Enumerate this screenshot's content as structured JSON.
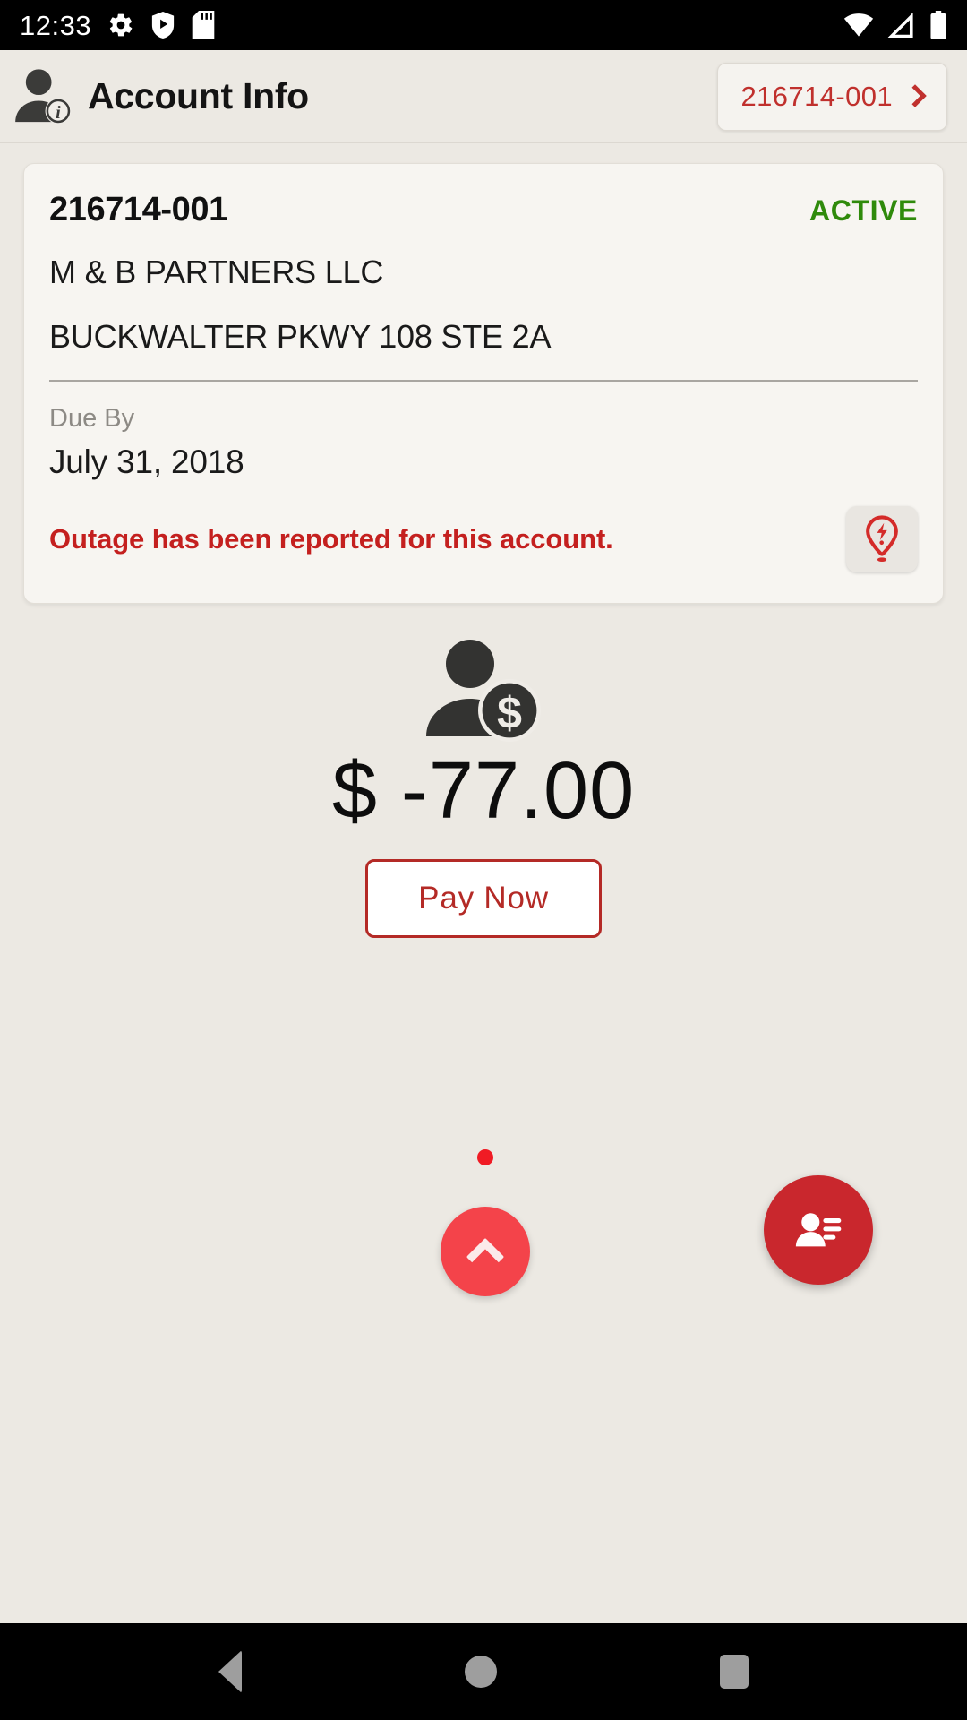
{
  "status_bar": {
    "time": "12:33",
    "left_icons": [
      "settings-gear-icon",
      "play-protect-icon",
      "sd-card-icon"
    ],
    "right_icons": [
      "wifi-icon",
      "cell-signal-icon",
      "battery-icon"
    ]
  },
  "header": {
    "icon": "account-info-person-icon",
    "title": "Account Info",
    "account_switcher": {
      "label": "216714-001",
      "chevron": "chevron-right-icon"
    }
  },
  "account_card": {
    "account_number": "216714-001",
    "status": "ACTIVE",
    "status_color": "#2f8a0b",
    "customer_name": "M & B PARTNERS LLC",
    "address": "BUCKWALTER PKWY 108 STE 2A",
    "due_by_label": "Due By",
    "due_by_value": "July 31, 2018",
    "outage_message": "Outage has been reported for this account.",
    "outage_message_color": "#c4201f",
    "outage_icon": "outage-pin-bolt-icon"
  },
  "balance": {
    "icon": "person-dollar-icon",
    "currency_symbol": "$",
    "amount": "-77.00",
    "display": "$ -77.00",
    "pay_button_label": "Pay Now",
    "pay_button_color": "#b42a26"
  },
  "floating": {
    "notification_dot": "red-dot-indicator",
    "expand_fab": "chevron-up-fab",
    "expand_fab_color": "#f4434a",
    "contacts_fab": "contacts-fab",
    "contacts_fab_color": "#c9272d"
  },
  "nav_bar": {
    "back": "back-triangle-icon",
    "home": "home-circle-icon",
    "recents": "recents-square-icon"
  }
}
